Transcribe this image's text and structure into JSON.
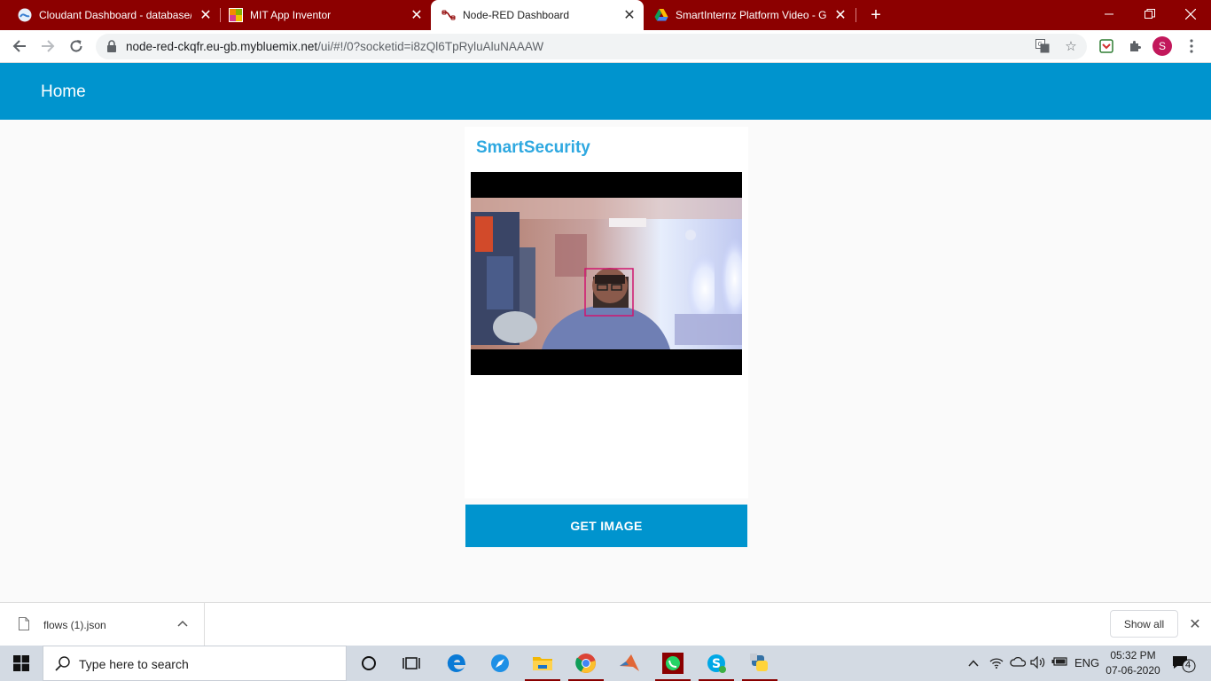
{
  "browser": {
    "tabs": [
      {
        "title": "Cloudant Dashboard - database/",
        "icon": "cloudant-icon"
      },
      {
        "title": "MIT App Inventor",
        "icon": "app-inventor-icon"
      },
      {
        "title": "Node-RED Dashboard",
        "icon": "node-red-icon"
      },
      {
        "title": "SmartInternz Platform Video - Go",
        "icon": "google-drive-icon"
      }
    ],
    "active_tab": 2,
    "url_host": "node-red-ckqfr.eu-gb.mybluemix.net",
    "url_path": "/ui/#!/0?socketid=i8zQl6TpRyluAluNAAAW",
    "profile_initial": "S"
  },
  "dashboard": {
    "header_title": "Home",
    "card_title": "SmartSecurity",
    "button_label": "GET IMAGE"
  },
  "downloads": {
    "file_name": "flows (1).json",
    "show_all_label": "Show all"
  },
  "taskbar": {
    "search_placeholder": "Type here to search",
    "language": "ENG",
    "time": "05:32 PM",
    "date": "07-06-2020",
    "notification_count": "4"
  },
  "colors": {
    "tab_strip": "#8c0000",
    "dashboard_accent": "#0094ce",
    "card_title": "#2ea8e0"
  }
}
